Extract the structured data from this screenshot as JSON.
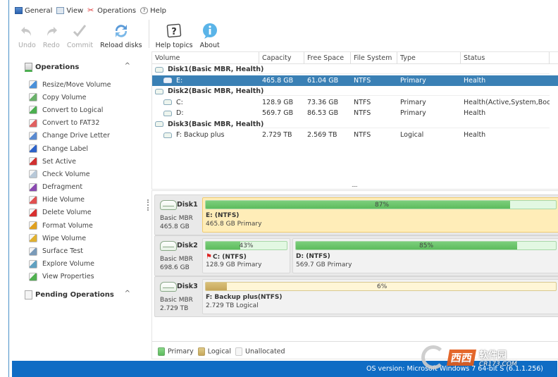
{
  "menu": {
    "items": [
      {
        "label": "General",
        "icon": "general-icon"
      },
      {
        "label": "View",
        "icon": "view-icon"
      },
      {
        "label": "Operations",
        "icon": "operations-icon"
      },
      {
        "label": "Help",
        "icon": "help-icon"
      }
    ]
  },
  "toolbar": {
    "undo": "Undo",
    "redo": "Redo",
    "commit": "Commit",
    "reload": "Reload disks",
    "help_topics": "Help topics",
    "about": "About"
  },
  "sidebar": {
    "operations_title": "Operations",
    "pending_title": "Pending Operations",
    "collapse_glyph": "^",
    "operations": [
      {
        "label": "Resize/Move Volume",
        "icon": "resize-icon",
        "color": "#4a90d9"
      },
      {
        "label": "Copy Volume",
        "icon": "copy-icon",
        "color": "#6ab06a"
      },
      {
        "label": "Convert to Logical",
        "icon": "convert-logical-icon",
        "color": "#4caf50"
      },
      {
        "label": "Convert to FAT32",
        "icon": "convert-fat32-icon",
        "color": "#e06060"
      },
      {
        "label": "Change Drive Letter",
        "icon": "pencil-icon",
        "color": "#5a8ad0"
      },
      {
        "label": "Change Label",
        "icon": "label-icon",
        "color": "#2d62c8"
      },
      {
        "label": "Set Active",
        "icon": "flag-icon",
        "color": "#d03030"
      },
      {
        "label": "Check Volume",
        "icon": "check-volume-icon",
        "color": "#b8c8d8"
      },
      {
        "label": "Defragment",
        "icon": "defragment-icon",
        "color": "#8a4ab0"
      },
      {
        "label": "Hide Volume",
        "icon": "hide-icon",
        "color": "#e05050"
      },
      {
        "label": "Delete Volume",
        "icon": "delete-icon",
        "color": "#d83030"
      },
      {
        "label": "Format Volume",
        "icon": "format-icon",
        "color": "#e0a020"
      },
      {
        "label": "Wipe Volume",
        "icon": "wipe-icon",
        "color": "#e0b030"
      },
      {
        "label": "Surface Test",
        "icon": "surface-test-icon",
        "color": "#7a9ab8"
      },
      {
        "label": "Explore Volume",
        "icon": "explore-icon",
        "color": "#60a0c0"
      },
      {
        "label": "View Properties",
        "icon": "properties-icon",
        "color": "#50b050"
      }
    ]
  },
  "table": {
    "columns": [
      "Volume",
      "Capacity",
      "Free Space",
      "File System",
      "Type",
      "Status"
    ],
    "disks": [
      {
        "title": "Disk1(Basic MBR, Health)",
        "volumes": [
          {
            "volume": "E:",
            "capacity": "465.8 GB",
            "free": "61.04 GB",
            "fs": "NTFS",
            "type": "Primary",
            "status": "Health",
            "selected": true
          }
        ]
      },
      {
        "title": "Disk2(Basic MBR, Health)",
        "volumes": [
          {
            "volume": "C:",
            "capacity": "128.9 GB",
            "free": "73.36 GB",
            "fs": "NTFS",
            "type": "Primary",
            "status": "Health(Active,System,Boot)"
          },
          {
            "volume": "D:",
            "capacity": "569.7 GB",
            "free": "86.53 GB",
            "fs": "NTFS",
            "type": "Primary",
            "status": "Health"
          }
        ]
      },
      {
        "title": "Disk3(Basic MBR, Health)",
        "volumes": [
          {
            "volume": "F: Backup plus",
            "capacity": "2.729 TB",
            "free": "2.569 TB",
            "fs": "NTFS",
            "type": "Logical",
            "status": "Health"
          }
        ]
      }
    ],
    "more_indicator": "....."
  },
  "diskmap": {
    "disks": [
      {
        "name": "Disk1",
        "type": "Basic MBR",
        "size": "465.8 GB",
        "partitions": [
          {
            "name": "E: (NTFS)",
            "info": "465.8 GB Primary",
            "used_pct": 87,
            "pct_label": "87%",
            "kind": "primary",
            "selected": true
          }
        ]
      },
      {
        "name": "Disk2",
        "type": "Basic MBR",
        "size": "698.6 GB",
        "partitions": [
          {
            "name": "C: (NTFS)",
            "info": "128.9 GB Primary",
            "used_pct": 43,
            "pct_label": "43%",
            "kind": "primary",
            "active_flag": true
          },
          {
            "name": "D: (NTFS)",
            "info": "569.7 GB Primary",
            "used_pct": 85,
            "pct_label": "85%",
            "kind": "primary"
          }
        ]
      },
      {
        "name": "Disk3",
        "type": "Basic MBR",
        "size": "2.729 TB",
        "partitions": [
          {
            "name": "F: Backup plus(NTFS)",
            "info": "2.729 TB Logical",
            "used_pct": 6,
            "pct_label": "6%",
            "kind": "logical"
          }
        ]
      }
    ],
    "legend": [
      {
        "label": "Primary",
        "color": "#6cc56c"
      },
      {
        "label": "Logical",
        "color": "#d4b86a"
      },
      {
        "label": "Unallocated",
        "color": "#f4f4f4"
      }
    ]
  },
  "statusbar": {
    "os_version": "OS version: Microsoft Windows 7  64-bit S (6.1.1.256)"
  },
  "watermark": {
    "brand_cn": "西西",
    "brand_cn2": "软件园",
    "site": "CR173.COM"
  },
  "colors": {
    "accent": "#0f6cc4",
    "selection": "#3a80b5",
    "selected_partition": "#ffedb8"
  }
}
